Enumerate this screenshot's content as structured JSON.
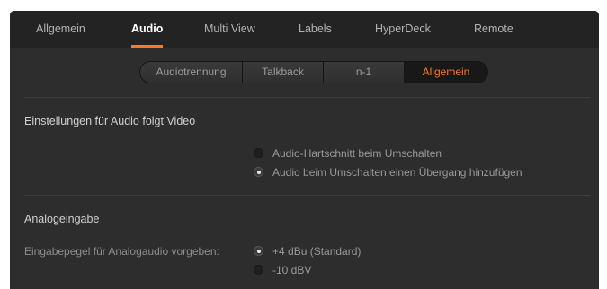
{
  "tabs": [
    {
      "label": "Allgemein",
      "active": false
    },
    {
      "label": "Audio",
      "active": true
    },
    {
      "label": "Multi View",
      "active": false
    },
    {
      "label": "Labels",
      "active": false
    },
    {
      "label": "HyperDeck",
      "active": false
    },
    {
      "label": "Remote",
      "active": false
    }
  ],
  "subtabs": [
    {
      "label": "Audiotrennung",
      "active": false
    },
    {
      "label": "Talkback",
      "active": false
    },
    {
      "label": "n-1",
      "active": false
    },
    {
      "label": "Allgemein",
      "active": true
    }
  ],
  "audio_follow_video": {
    "heading": "Einstellungen für Audio folgt Video",
    "options": [
      {
        "label": "Audio-Hartschnitt beim Umschalten",
        "selected": false
      },
      {
        "label": "Audio beim Umschalten einen Übergang hinzufügen",
        "selected": true
      }
    ]
  },
  "analog_input": {
    "heading": "Analogeingabe",
    "field_label": "Eingabepegel für Analogaudio vorgeben:",
    "options": [
      {
        "label": "+4 dBu (Standard)",
        "selected": true
      },
      {
        "label": "-10 dBV",
        "selected": false
      }
    ]
  },
  "colors": {
    "accent": "#ff7b1c",
    "panel": "#2d2d2d",
    "tabbar": "#232323"
  }
}
